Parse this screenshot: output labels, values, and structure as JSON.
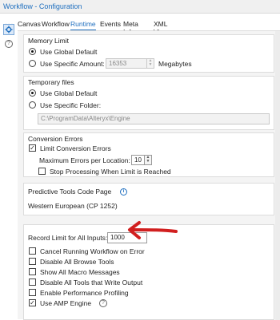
{
  "window": {
    "title": "Workflow - Configuration"
  },
  "sidebar": {
    "dots": "..."
  },
  "tabs": [
    {
      "label": "Canvas"
    },
    {
      "label": "Workflow"
    },
    {
      "label": "Runtime"
    },
    {
      "label": "Events"
    },
    {
      "label": "Meta Info"
    },
    {
      "label": "XML View"
    }
  ],
  "active_tab": "Runtime",
  "memory_limit": {
    "title": "Memory Limit",
    "option_global": "Use Global Default",
    "option_specific": "Use Specific Amount:",
    "amount": "16353",
    "unit": "Megabytes"
  },
  "temporary_files": {
    "title": "Temporary files",
    "option_global": "Use Global Default",
    "option_specific": "Use Specific Folder:",
    "folder": "C:\\ProgramData\\Alteryx\\Engine"
  },
  "conversion_errors": {
    "title": "Conversion Errors",
    "limit_label": "Limit Conversion Errors",
    "limit_checked": true,
    "max_errors_label": "Maximum Errors per Location:",
    "max_errors_value": "10",
    "stop_label": "Stop Processing When Limit is Reached",
    "stop_checked": false
  },
  "predictive_tools": {
    "title": "Predictive Tools Code Page",
    "value": "Western European (CP 1252)"
  },
  "general": {
    "record_limit_label": "Record Limit for All Inputs:",
    "record_limit_value": "1000",
    "options": [
      {
        "label": "Cancel Running Workflow on Error",
        "checked": false
      },
      {
        "label": "Disable All Browse Tools",
        "checked": false
      },
      {
        "label": "Show All Macro Messages",
        "checked": false
      },
      {
        "label": "Disable All Tools that Write Output",
        "checked": false
      },
      {
        "label": "Enable Performance Profiling",
        "checked": false
      },
      {
        "label": "Use AMP Engine",
        "checked": true
      }
    ]
  },
  "colors": {
    "accent": "#1f6fbf",
    "annotation_arrow": "#d11f1f"
  }
}
